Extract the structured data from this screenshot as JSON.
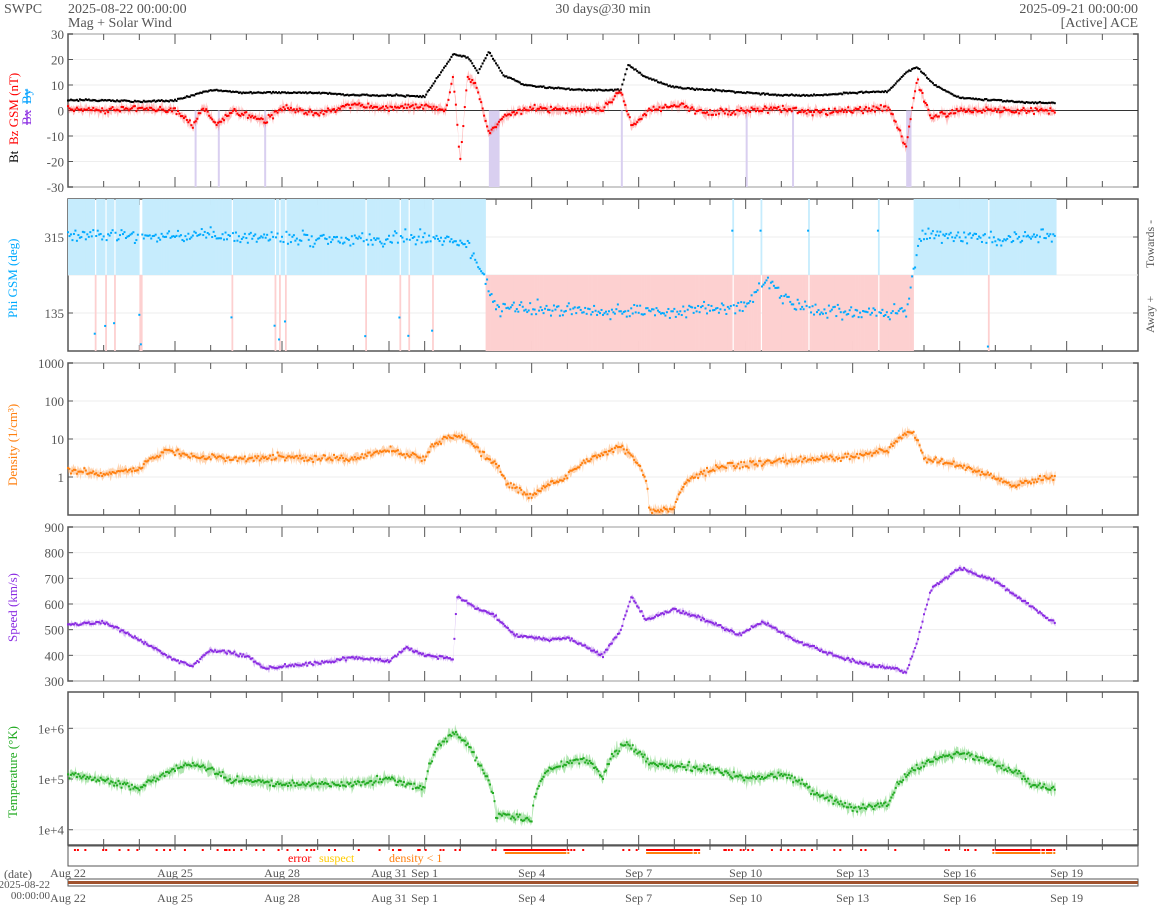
{
  "header": {
    "org": "SWPC",
    "start_time": "2025-08-22 00:00:00",
    "subtitle": "Mag + Solar Wind",
    "span": "30 days@30 min",
    "end_time": "2025-09-21 00:00:00",
    "source": "[Active] ACE"
  },
  "colors": {
    "bt": "#000000",
    "bz": "#ff0000",
    "bx": "#8a2be2",
    "by": "#00a0ff",
    "phi": "#00aaff",
    "density": "#ff7f0e",
    "speed": "#8a2be2",
    "temp": "#22aa22",
    "error": "#ff0000",
    "suspect": "#ffcc00",
    "lowdens": "#ff7f0e",
    "timebar": "#a0522d"
  },
  "chart_data": [
    {
      "type": "scatter",
      "title": "Mag",
      "ylabel_parts": [
        "Bt",
        "Bz GSM (nT)",
        "Bx",
        "By"
      ],
      "ylim": [
        -30,
        30
      ],
      "yticks": [
        "30",
        "20",
        "10",
        "0",
        "-10",
        "-20",
        "-30"
      ],
      "x_unit": "days since 2025-08-22",
      "series": [
        {
          "name": "Bt",
          "points": [
            [
              0,
              4
            ],
            [
              1,
              4
            ],
            [
              2,
              3.5
            ],
            [
              3,
              4
            ],
            [
              4,
              8
            ],
            [
              5,
              7
            ],
            [
              6,
              7
            ],
            [
              7,
              7
            ],
            [
              8,
              6
            ],
            [
              9,
              6
            ],
            [
              10,
              5.5
            ],
            [
              10.8,
              22
            ],
            [
              11.2,
              21
            ],
            [
              11.5,
              15
            ],
            [
              11.8,
              23
            ],
            [
              12.2,
              14
            ],
            [
              12.8,
              10
            ],
            [
              13.5,
              9
            ],
            [
              14.5,
              8
            ],
            [
              15.5,
              8
            ],
            [
              15.7,
              18
            ],
            [
              16.2,
              13
            ],
            [
              17,
              9
            ],
            [
              18,
              8
            ],
            [
              19,
              7
            ],
            [
              20,
              6
            ],
            [
              21,
              6
            ],
            [
              22,
              7
            ],
            [
              23,
              7.5
            ],
            [
              23.5,
              15
            ],
            [
              23.8,
              17
            ],
            [
              24.3,
              10
            ],
            [
              25,
              5
            ],
            [
              26,
              4
            ],
            [
              27,
              3
            ],
            [
              27.7,
              3
            ]
          ]
        },
        {
          "name": "Bz",
          "points": [
            [
              0,
              1
            ],
            [
              1,
              0
            ],
            [
              2,
              1
            ],
            [
              3,
              0
            ],
            [
              3.5,
              -6
            ],
            [
              3.8,
              1
            ],
            [
              4.2,
              -6
            ],
            [
              4.6,
              0
            ],
            [
              5.5,
              -4
            ],
            [
              6,
              1
            ],
            [
              7,
              -1
            ],
            [
              8,
              2
            ],
            [
              9,
              1
            ],
            [
              10,
              2
            ],
            [
              10.6,
              0
            ],
            [
              10.8,
              14
            ],
            [
              11.0,
              -20
            ],
            [
              11.2,
              14
            ],
            [
              11.5,
              8
            ],
            [
              11.8,
              -9
            ],
            [
              12.3,
              -2
            ],
            [
              13,
              1
            ],
            [
              14,
              0
            ],
            [
              15,
              1
            ],
            [
              15.5,
              8
            ],
            [
              15.8,
              -6
            ],
            [
              16.3,
              0
            ],
            [
              17,
              2
            ],
            [
              18,
              -1
            ],
            [
              19,
              0
            ],
            [
              20,
              1
            ],
            [
              21,
              -1
            ],
            [
              22,
              0
            ],
            [
              23,
              1
            ],
            [
              23.5,
              -14
            ],
            [
              23.8,
              12
            ],
            [
              24.2,
              -3
            ],
            [
              25,
              0
            ],
            [
              26,
              0
            ],
            [
              27,
              0
            ],
            [
              27.7,
              0
            ]
          ]
        }
      ]
    },
    {
      "type": "scatter",
      "title": "Phi",
      "ylabel": "Phi GSM (deg)",
      "ylim": [
        45,
        405
      ],
      "yticks": [
        "315",
        "135"
      ],
      "sector_labels": [
        "Towards -",
        "Away +"
      ],
      "series": [
        {
          "name": "Phi",
          "points": [
            [
              0,
              320
            ],
            [
              5,
              315
            ],
            [
              10,
              310
            ],
            [
              11.2,
              300
            ],
            [
              11.6,
              230
            ],
            [
              12,
              150
            ],
            [
              13,
              145
            ],
            [
              15,
              140
            ],
            [
              17,
              140
            ],
            [
              19,
              150
            ],
            [
              19.6,
              215
            ],
            [
              20.2,
              160
            ],
            [
              21,
              140
            ],
            [
              22.5,
              135
            ],
            [
              23.5,
              140
            ],
            [
              23.9,
              320
            ],
            [
              26,
              310
            ],
            [
              27.7,
              320
            ]
          ]
        }
      ]
    },
    {
      "type": "scatter",
      "title": "Density",
      "ylabel": "Density (1/cm³)",
      "yscale": "log",
      "ylim": [
        0.1,
        1000
      ],
      "yticks": [
        "1000",
        "100",
        "10",
        "1"
      ],
      "series": [
        {
          "name": "Density",
          "points": [
            [
              0,
              1.5
            ],
            [
              1,
              1.2
            ],
            [
              2,
              1.6
            ],
            [
              2.8,
              5
            ],
            [
              3.5,
              3.5
            ],
            [
              5,
              3
            ],
            [
              6,
              3.5
            ],
            [
              7,
              3
            ],
            [
              8,
              3
            ],
            [
              9,
              5
            ],
            [
              10,
              3
            ],
            [
              10.5,
              10
            ],
            [
              11,
              12
            ],
            [
              11.6,
              4
            ],
            [
              12.3,
              0.6
            ],
            [
              13,
              0.3
            ],
            [
              14,
              1
            ],
            [
              15,
              4
            ],
            [
              15.5,
              6
            ],
            [
              16,
              2
            ],
            [
              16.3,
              0.12
            ],
            [
              17,
              0.15
            ],
            [
              17.5,
              1
            ],
            [
              18.5,
              2
            ],
            [
              20,
              2.5
            ],
            [
              21,
              3
            ],
            [
              22,
              3.5
            ],
            [
              23,
              5
            ],
            [
              23.6,
              16
            ],
            [
              24,
              3
            ],
            [
              25,
              2
            ],
            [
              26,
              0.9
            ],
            [
              26.5,
              0.6
            ],
            [
              27.7,
              1
            ]
          ]
        }
      ]
    },
    {
      "type": "scatter",
      "title": "Speed",
      "ylabel": "Speed (km/s)",
      "ylim": [
        300,
        900
      ],
      "yticks": [
        "900",
        "800",
        "700",
        "600",
        "500",
        "400",
        "300"
      ],
      "series": [
        {
          "name": "Speed",
          "points": [
            [
              0,
              520
            ],
            [
              1,
              530
            ],
            [
              2,
              460
            ],
            [
              2.5,
              420
            ],
            [
              3,
              380
            ],
            [
              3.5,
              360
            ],
            [
              4,
              420
            ],
            [
              5,
              400
            ],
            [
              5.5,
              350
            ],
            [
              7,
              370
            ],
            [
              8,
              390
            ],
            [
              9,
              380
            ],
            [
              9.5,
              430
            ],
            [
              10,
              400
            ],
            [
              10.8,
              385
            ],
            [
              10.9,
              630
            ],
            [
              11.5,
              580
            ],
            [
              12,
              550
            ],
            [
              12.5,
              480
            ],
            [
              13.5,
              460
            ],
            [
              14,
              470
            ],
            [
              15,
              400
            ],
            [
              15.5,
              500
            ],
            [
              15.8,
              630
            ],
            [
              16.2,
              540
            ],
            [
              17,
              580
            ],
            [
              18,
              530
            ],
            [
              18.8,
              480
            ],
            [
              19.5,
              530
            ],
            [
              20.5,
              450
            ],
            [
              21.5,
              400
            ],
            [
              22.5,
              360
            ],
            [
              23.2,
              350
            ],
            [
              23.5,
              330
            ],
            [
              23.8,
              450
            ],
            [
              24.2,
              660
            ],
            [
              25,
              740
            ],
            [
              26,
              690
            ],
            [
              27,
              590
            ],
            [
              27.7,
              520
            ]
          ]
        }
      ]
    },
    {
      "type": "scatter",
      "title": "Temperature",
      "ylabel": "Temperature (°K)",
      "yscale": "log",
      "ylim": [
        5000,
        5200000
      ],
      "yticks": [
        "1e+6",
        "1e+5",
        "1e+4"
      ],
      "series": [
        {
          "name": "Temperature",
          "points": [
            [
              0,
              125000
            ],
            [
              2,
              63000
            ],
            [
              3.5,
              200000
            ],
            [
              4.5,
              100000
            ],
            [
              6,
              80000
            ],
            [
              8,
              80000
            ],
            [
              9,
              100000
            ],
            [
              10,
              63000
            ],
            [
              10.8,
              800000
            ],
            [
              11.5,
              200000
            ],
            [
              12,
              20000
            ],
            [
              13,
              16000
            ],
            [
              13.5,
              160000
            ],
            [
              14.5,
              250000
            ],
            [
              15,
              100000
            ],
            [
              15.6,
              500000
            ],
            [
              16.3,
              200000
            ],
            [
              18,
              160000
            ],
            [
              19,
              100000
            ],
            [
              20,
              125000
            ],
            [
              21,
              50000
            ],
            [
              22,
              25000
            ],
            [
              23,
              32000
            ],
            [
              24,
              200000
            ],
            [
              25,
              320000
            ],
            [
              26,
              200000
            ],
            [
              27,
              80000
            ],
            [
              27.7,
              63000
            ]
          ]
        }
      ]
    }
  ],
  "flags": {
    "legend": [
      "error",
      "suspect",
      "density < 1"
    ]
  },
  "xaxis": {
    "date_label": "(date)",
    "start_label_1": "2025-08-22",
    "start_label_2": "00:00:00",
    "ticks": [
      {
        "day": 0,
        "label": "Aug 22"
      },
      {
        "day": 3,
        "label": "Aug 25"
      },
      {
        "day": 6,
        "label": "Aug 28"
      },
      {
        "day": 9,
        "label": "Aug 31"
      },
      {
        "day": 10,
        "label": "Sep 1"
      },
      {
        "day": 13,
        "label": "Sep 4"
      },
      {
        "day": 16,
        "label": "Sep 7"
      },
      {
        "day": 19,
        "label": "Sep 10"
      },
      {
        "day": 22,
        "label": "Sep 13"
      },
      {
        "day": 25,
        "label": "Sep 16"
      },
      {
        "day": 28,
        "label": "Sep 19"
      }
    ],
    "total_days": 30
  }
}
